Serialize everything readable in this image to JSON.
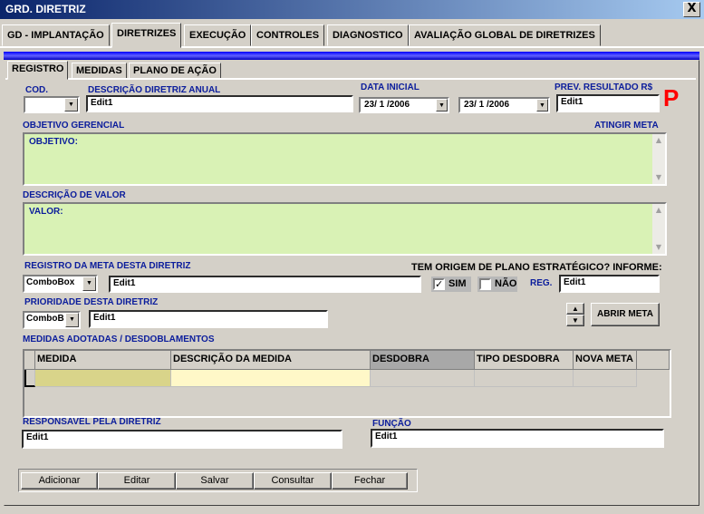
{
  "window": {
    "title": "GRD. DIRETRIZ",
    "close_glyph": "X"
  },
  "main_tabs": [
    {
      "label": "GD - IMPLANTAÇÃO"
    },
    {
      "label": "DIRETRIZES"
    },
    {
      "label": "EXECUÇÃO"
    },
    {
      "label": "CONTROLES"
    },
    {
      "label": "DIAGNOSTICO"
    },
    {
      "label": "AVALIAÇÃO GLOBAL DE DIRETRIZES"
    }
  ],
  "sub_tabs": [
    {
      "label": "REGISTRO"
    },
    {
      "label": "MEDIDAS"
    },
    {
      "label": "PLANO DE AÇÃO"
    }
  ],
  "form": {
    "cod_label": "COD.",
    "descricao_label": "DESCRIÇÃO DIRETRIZ ANUAL",
    "descricao_value": "Edit1",
    "data_inicial_label": "DATA INICIAL",
    "data_inicial_value": "23/ 1 /2006",
    "data_final_value": "23/ 1 /2006",
    "prev_resultado_label": "PREV. RESULTADO R$",
    "prev_resultado_value": "Edit1",
    "status_letter": "P",
    "objetivo_label": "OBJETIVO GERENCIAL",
    "atingir_meta_label": "ATINGIR META",
    "objetivo_text": "OBJETIVO:",
    "valor_label": "DESCRIÇÃO DE VALOR",
    "valor_text": "VALOR:",
    "registro_meta_label": "REGISTRO DA META  DESTA DIRETRIZ",
    "registro_combo_value": "ComboBox",
    "registro_meta_value": "Edit1",
    "origem_label": "TEM ORIGEM DE PLANO ESTRATÉGICO? INFORME:",
    "sim_label": "SIM",
    "sim_checked": true,
    "nao_label": "NÃO",
    "nao_checked": false,
    "reg_label": "REG.",
    "reg_value": "Edit1",
    "prioridade_label": "PRIORIDADE DESTA DIRETRIZ",
    "prioridade_combo_value": "ComboB",
    "prioridade_value": "Edit1",
    "abrir_meta_label": "ABRIR META",
    "medidas_label": "MEDIDAS ADOTADAS / DESDOBLAMENTOS",
    "responsavel_label": "RESPONSAVEL PELA DIRETRIZ",
    "responsavel_value": "Edit1",
    "funcao_label": "FUNÇÃO",
    "funcao_value": "Edit1"
  },
  "grid": {
    "columns": [
      {
        "label": "MEDIDA"
      },
      {
        "label": "DESCRIÇÃO DA MEDIDA"
      },
      {
        "label": "DESDOBRA"
      },
      {
        "label": "TIPO DESDOBRA"
      },
      {
        "label": "NOVA META"
      }
    ],
    "colors": {
      "medida_cell": "#d9d48a",
      "descricao_cell": "#fff8c8",
      "desdobra_header": "#a8a8a8"
    }
  },
  "bottom_buttons": [
    {
      "label": "Adicionar"
    },
    {
      "label": "Editar"
    },
    {
      "label": "Salvar"
    },
    {
      "label": "Consultar"
    },
    {
      "label": "Fechar"
    }
  ],
  "colors": {
    "title_bar": "#0a246a",
    "label_blue": "#0b1d9c",
    "text_area_green": "#d9f2b5",
    "status_red": "#ff0000"
  },
  "icons": [
    "close-icon",
    "dropdown-arrow-icon",
    "spin-up-icon",
    "spin-down-icon",
    "scroll-up-icon",
    "scroll-down-icon"
  ]
}
